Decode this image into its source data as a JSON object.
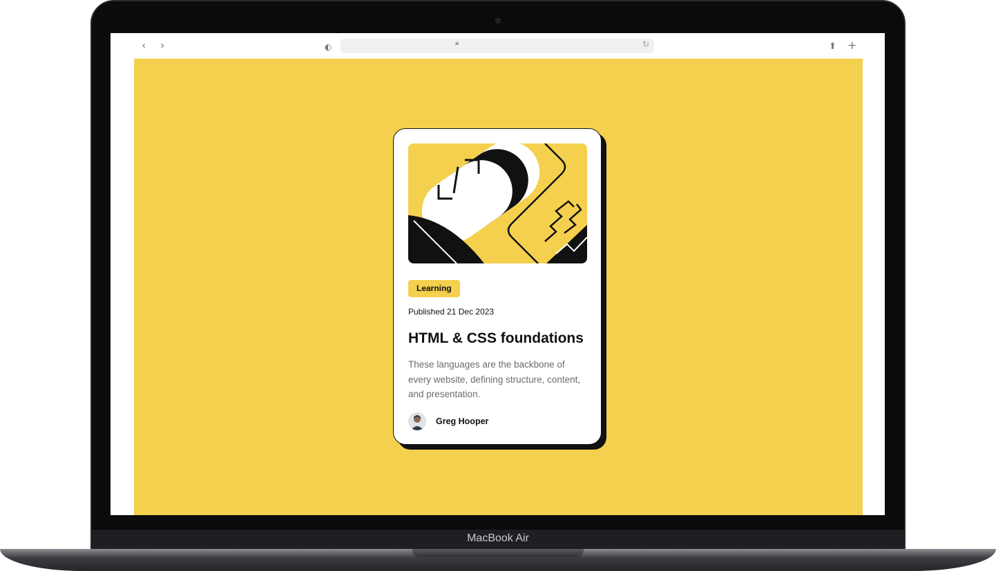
{
  "device": {
    "model_label": "MacBook Air"
  },
  "browser": {
    "back_icon": "chevron-left-icon",
    "forward_icon": "chevron-right-icon",
    "privacy_icon": "shield-icon",
    "lock_icon": "lock-icon",
    "reload_icon": "reload-icon",
    "share_icon": "share-icon",
    "new_tab_icon": "plus-icon"
  },
  "page": {
    "background_color": "#f4d04e",
    "card": {
      "category": "Learning",
      "published": "Published 21 Dec 2023",
      "title": "HTML & CSS foundations",
      "description": "These languages are the backbone of every website, defining structure, content, and presentation.",
      "author": {
        "name": "Greg Hooper"
      },
      "accent_color": "#f4d04e",
      "ink_color": "#111111"
    }
  }
}
